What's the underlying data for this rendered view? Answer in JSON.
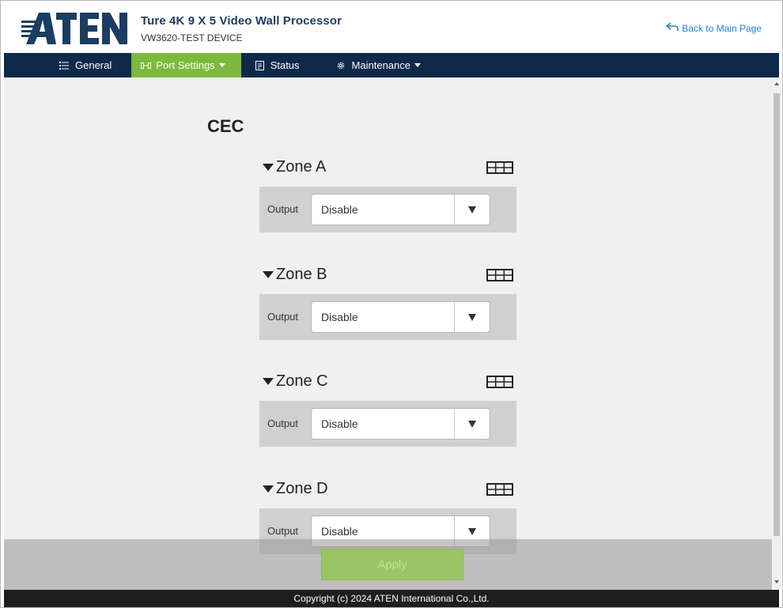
{
  "header": {
    "logo_text": "ATEN",
    "title": "Ture 4K 9 X 5 Video Wall Processor",
    "subtitle": "VW3620-TEST DEVICE",
    "back_label": "Back to Main Page"
  },
  "nav": {
    "items": [
      {
        "label": "General",
        "icon": "list-icon",
        "active": false
      },
      {
        "label": "Port Settings",
        "icon": "port-icon",
        "active": true,
        "dropdown": true
      },
      {
        "label": "Status",
        "icon": "status-icon",
        "active": false
      },
      {
        "label": "Maintenance",
        "icon": "gear-icon",
        "active": false,
        "dropdown": true
      }
    ]
  },
  "main": {
    "section_title": "CEC",
    "output_label": "Output",
    "zones": [
      {
        "name": "Zone A",
        "output": "Disable"
      },
      {
        "name": "Zone B",
        "output": "Disable"
      },
      {
        "name": "Zone C",
        "output": "Disable"
      },
      {
        "name": "Zone D",
        "output": "Disable"
      }
    ],
    "apply_label": "Apply"
  },
  "footer": {
    "copyright": "Copyright (c) 2024 ATEN International Co.,Ltd."
  },
  "colors": {
    "nav_bg": "#0e2a4b",
    "nav_active": "#7db93c",
    "title": "#1c3d63",
    "link": "#1f7ed8",
    "footer_bg": "#1e1e1e",
    "content_bg": "#f0f0f0",
    "zone_panel": "#d0d0d0"
  }
}
